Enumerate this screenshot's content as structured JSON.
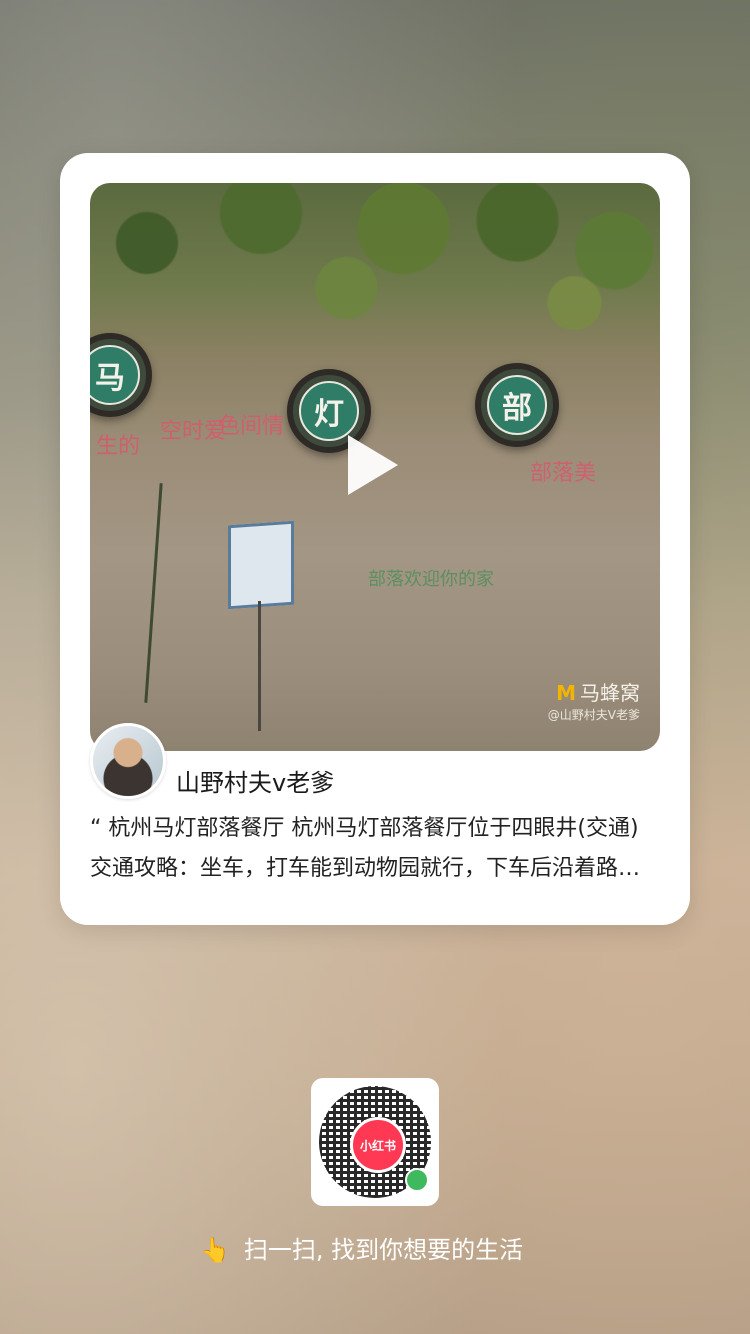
{
  "photo": {
    "signs": [
      "马",
      "灯",
      "部"
    ],
    "watermark_brand": "马蜂窝",
    "watermark_user": "@山野村夫V老爹"
  },
  "author": {
    "name": "山野村夫v老爹"
  },
  "note": {
    "description": "“ 杭州马灯部落餐厅 杭州马灯部落餐厅位于四眼井(交通)交通攻略：坐车，打车能到动物园就行，下车后沿着路往上走，就能看到了"
  },
  "qr": {
    "logo_text": "小红书"
  },
  "footer": {
    "hand_icon": "👆",
    "slogan": "扫一扫, 找到你想要的生活"
  }
}
